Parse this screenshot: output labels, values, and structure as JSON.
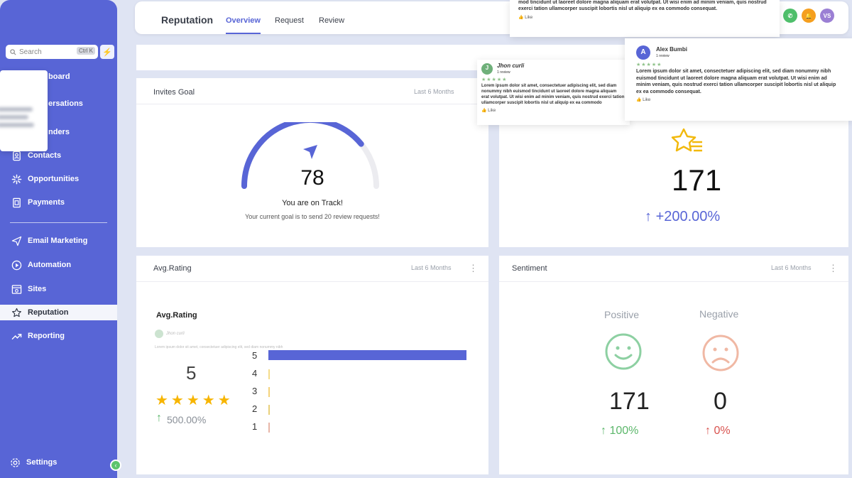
{
  "sidebar": {
    "search_placeholder": "Search",
    "search_shortcut": "Ctrl K",
    "items": [
      {
        "label": "Dashboard",
        "visible": "board"
      },
      {
        "label": "Conversations",
        "visible": "ersations"
      },
      {
        "label": "Calendars",
        "visible": "nders"
      },
      {
        "label": "Contacts",
        "visible": "Contacts"
      },
      {
        "label": "Opportunities",
        "visible": "Opportunities"
      },
      {
        "label": "Payments",
        "visible": "Payments"
      },
      {
        "label": "Email Marketing",
        "visible": "Email Marketing"
      },
      {
        "label": "Automation",
        "visible": "Automation"
      },
      {
        "label": "Sites",
        "visible": "Sites"
      },
      {
        "label": "Reputation",
        "visible": "Reputation"
      },
      {
        "label": "Reporting",
        "visible": "Reporting"
      }
    ],
    "settings": "Settings"
  },
  "header": {
    "title": "Reputation",
    "tabs": [
      "Overview",
      "Request",
      "Review"
    ],
    "active_tab": "Overview",
    "user_initials": "VS",
    "colors": {
      "accent": "#5865d6"
    }
  },
  "invites_goal": {
    "title": "Invites Goal",
    "period": "Last 6 Months",
    "value": "78",
    "progress_fraction": 0.78,
    "message": "You are on Track!",
    "sub_message": "Your current goal is to send 20 review requests!"
  },
  "reviews_received": {
    "value": "171",
    "change": "+200.00%"
  },
  "avg_rating": {
    "title": "Avg.Rating",
    "period": "Last 6 Months",
    "subtitle": "Avg.Rating",
    "value": "5",
    "stars": 5,
    "change": "500.00%",
    "breakdown": [
      {
        "label": "5",
        "fraction": 1.0
      },
      {
        "label": "4",
        "fraction": 0
      },
      {
        "label": "3",
        "fraction": 0
      },
      {
        "label": "2",
        "fraction": 0
      },
      {
        "label": "1",
        "fraction": 0
      }
    ]
  },
  "sentiment": {
    "title": "Sentiment",
    "period": "Last 6 Months",
    "positive_label": "Positive",
    "negative_label": "Negative",
    "positive_value": "171",
    "negative_value": "0",
    "positive_change": "100%",
    "negative_change": "0%"
  },
  "review_popups": [
    {
      "initial": "J",
      "name": "Jhon curli",
      "count": "1 review",
      "body": "Lorem ipsum dolor sit amet, consectetuer adipiscing elit, sed diam nonummy nibh euismod tincidunt ut laoreet dolore magna aliquam erat volutpat. Ut wisi enim ad minim veniam, quis nostrud exerci tation ullamcorper suscipit lobortis nisl ut aliquip ex ea commodo consequat.",
      "like": "Like"
    },
    {
      "initial": "A",
      "name": "Alex Bumbi",
      "count": "1 review",
      "body": "Lorem ipsum dolor sit amet, consectetuer adipiscing elit, sed diam nonummy nibh euismod tincidunt ut laoreet dolore magna aliquam erat volutpat. Ut wisi enim ad minim veniam, quis nostrud exerci tation ullamcorper suscipit lobortis nisl ut aliquip ex ea commodo consequat.",
      "like": "Like"
    },
    {
      "body_top": "mod tincidunt ut laoreet dolore magna aliquam erat volutpat. Ut wisi enim ad minim veniam, quis nostrud exerci tation ullamcorper suscipit lobortis nisl ut aliquip ex ea commodo consequat.",
      "like": "Like"
    }
  ]
}
